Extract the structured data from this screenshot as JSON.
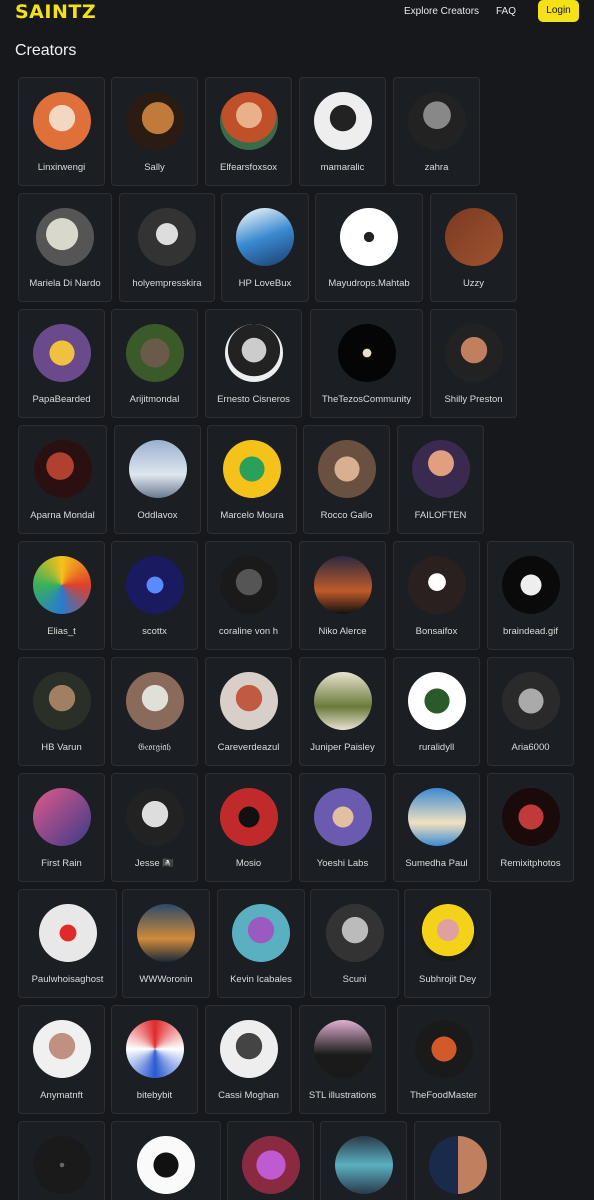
{
  "header": {
    "logo": "SAINTZ",
    "nav": [
      "Explore Creators",
      "FAQ"
    ],
    "login_label": "Login"
  },
  "page": {
    "title": "Creators"
  },
  "colors": {
    "accent": "#f5e11a",
    "background": "#16181c",
    "card_border": "#2c3036"
  },
  "creators": [
    {
      "name": "Linxirwengi"
    },
    {
      "name": "Sally"
    },
    {
      "name": "Elfearsfoxsox"
    },
    {
      "name": "mamaralic"
    },
    {
      "name": "zahra"
    },
    {
      "name": "Mariela Di Nardo"
    },
    {
      "name": "holyempresskira"
    },
    {
      "name": "HP LoveBux"
    },
    {
      "name": "Mayudrops.Mahtab"
    },
    {
      "name": "Uzzy"
    },
    {
      "name": "PapaBearded"
    },
    {
      "name": "Arijitmondal"
    },
    {
      "name": "Ernesto Cisneros"
    },
    {
      "name": "TheTezosCommunity"
    },
    {
      "name": "Shilly Preston"
    },
    {
      "name": "Aparna Mondal"
    },
    {
      "name": "Oddlavox"
    },
    {
      "name": "Marcelo Moura"
    },
    {
      "name": "Rocco Gallo"
    },
    {
      "name": "FAILOFTEN"
    },
    {
      "name": "Elias_t"
    },
    {
      "name": "scottx"
    },
    {
      "name": "coraline von h"
    },
    {
      "name": "Niko Alerce"
    },
    {
      "name": "Bonsaifox"
    },
    {
      "name": "braindead.gif"
    },
    {
      "name": "HB Varun"
    },
    {
      "name": "𝔊𝔢𝔬𝔯𝔤𝔦𝔞𝔥"
    },
    {
      "name": "Careverdeazul"
    },
    {
      "name": "Juniper Paisley"
    },
    {
      "name": "ruralidyll"
    },
    {
      "name": "Aria6000"
    },
    {
      "name": "First Rain"
    },
    {
      "name": "Jesse 🏴‍☠️"
    },
    {
      "name": "Mosio"
    },
    {
      "name": "Yoeshi Labs"
    },
    {
      "name": "Sumedha Paul"
    },
    {
      "name": "Remixitphotos"
    },
    {
      "name": "Paulwhoisaghost"
    },
    {
      "name": "WWWoronin"
    },
    {
      "name": "Kevin Icabales"
    },
    {
      "name": "Scuni"
    },
    {
      "name": "Subhrojit Dey"
    },
    {
      "name": "Anymatnft"
    },
    {
      "name": "bitebybit"
    },
    {
      "name": "Cassi Moghan"
    },
    {
      "name": "STL illustrations"
    },
    {
      "name": "TheFoodMaster"
    },
    {
      "name": ""
    },
    {
      "name": ""
    },
    {
      "name": ""
    },
    {
      "name": ""
    },
    {
      "name": ""
    }
  ]
}
